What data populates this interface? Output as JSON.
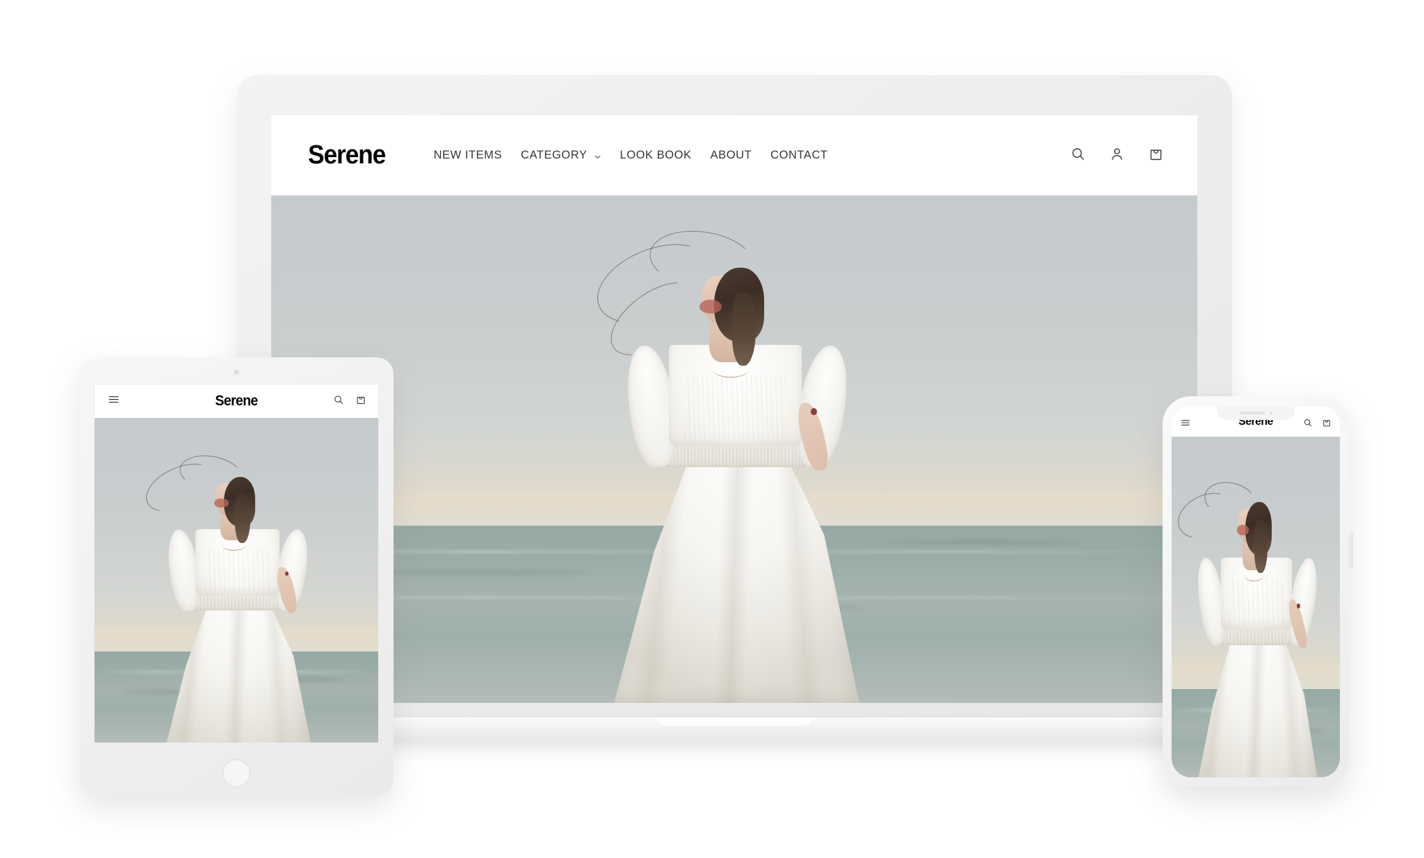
{
  "site": {
    "brand": "Serene",
    "nav": [
      {
        "label": "NEW ITEMS",
        "has_dropdown": false
      },
      {
        "label": "CATEGORY",
        "has_dropdown": true
      },
      {
        "label": "LOOK BOOK",
        "has_dropdown": false
      },
      {
        "label": "ABOUT",
        "has_dropdown": false
      },
      {
        "label": "CONTACT",
        "has_dropdown": false
      }
    ],
    "icons": {
      "search": "search-icon",
      "account": "account-icon",
      "cart": "shopping-bag-icon",
      "menu": "hamburger-menu-icon",
      "chevron": "chevron-down-icon"
    }
  },
  "hero": {
    "alt": "Woman in white puff-sleeve dress on a beach with hair blowing in the wind",
    "sky_color": "#c5cbcd",
    "horizon_color": "#e5dccb",
    "sea_color": "#9aaca7",
    "dress_color": "#f8f7f3",
    "hair_color": "#3b2e25"
  },
  "devices": {
    "laptop": {
      "name": "laptop",
      "frame_color": "#eeeeee"
    },
    "tablet": {
      "name": "tablet",
      "frame_color": "#f1f1f1"
    },
    "phone": {
      "name": "phone",
      "frame_color": "#f3f3f3"
    }
  },
  "page": {
    "background": "#ffffff"
  }
}
